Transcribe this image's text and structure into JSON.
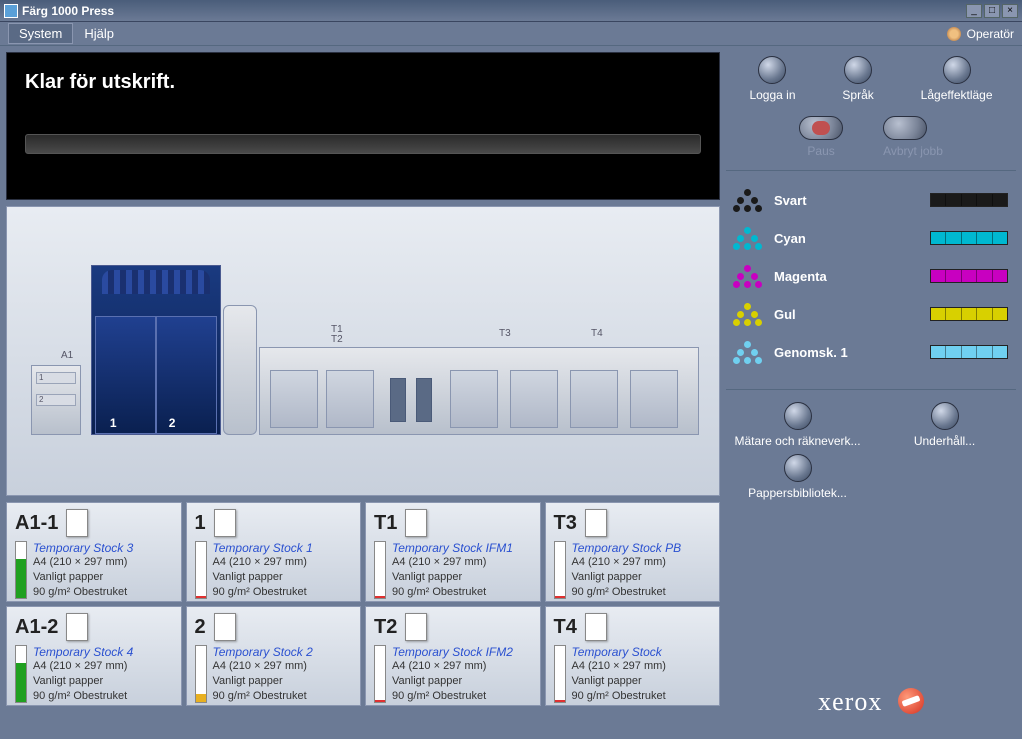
{
  "window": {
    "title": "Färg 1000 Press"
  },
  "menu": {
    "system": "System",
    "help": "Hjälp",
    "operator": "Operatör"
  },
  "status": {
    "message": "Klar för utskrift."
  },
  "actions": {
    "login": "Logga in",
    "language": "Språk",
    "lowpower": "Lågeffektläge",
    "pause": "Paus",
    "cancel": "Avbryt jobb",
    "meters": "Mätare och räkneverk...",
    "maintenance": "Underhåll...",
    "paperlib": "Pappersbibliotek..."
  },
  "toners": [
    {
      "name": "Svart",
      "color": "#1a1a1a"
    },
    {
      "name": "Cyan",
      "color": "#00b8d0"
    },
    {
      "name": "Magenta",
      "color": "#c800c0"
    },
    {
      "name": "Gul",
      "color": "#d8d000"
    },
    {
      "name": "Genomsk. 1",
      "color": "#70d0f0"
    }
  ],
  "diagram": {
    "a1": "A1",
    "n1": "1",
    "n2": "2",
    "t1": "T1",
    "t2": "T2",
    "t3": "T3",
    "t4": "T4"
  },
  "trays": [
    {
      "id": "A1-1",
      "stock": "Temporary Stock 3",
      "size": "A4 (210 × 297 mm)",
      "type": "Vanligt papper",
      "weight": "90 g/m²  Obestruket",
      "fill": 70,
      "fillColor": "#20a020"
    },
    {
      "id": "1",
      "stock": "Temporary Stock 1",
      "size": "A4 (210 × 297 mm)",
      "type": "Vanligt papper",
      "weight": "90 g/m²  Obestruket",
      "fill": 4,
      "fillColor": "#e03030"
    },
    {
      "id": "T1",
      "stock": "Temporary Stock IFM1",
      "size": "A4 (210 × 297 mm)",
      "type": "Vanligt papper",
      "weight": "90 g/m²  Obestruket",
      "fill": 4,
      "fillColor": "#e03030"
    },
    {
      "id": "T3",
      "stock": "Temporary Stock PB",
      "size": "A4 (210 × 297 mm)",
      "type": "Vanligt papper",
      "weight": "90 g/m²  Obestruket",
      "fill": 4,
      "fillColor": "#e03030"
    },
    {
      "id": "A1-2",
      "stock": "Temporary Stock 4",
      "size": "A4 (210 × 297 mm)",
      "type": "Vanligt papper",
      "weight": "90 g/m²  Obestruket",
      "fill": 70,
      "fillColor": "#20a020"
    },
    {
      "id": "2",
      "stock": "Temporary Stock 2",
      "size": "A4 (210 × 297 mm)",
      "type": "Vanligt papper",
      "weight": "90 g/m²  Obestruket",
      "fill": 15,
      "fillColor": "#e8b020"
    },
    {
      "id": "T2",
      "stock": "Temporary Stock IFM2",
      "size": "A4 (210 × 297 mm)",
      "type": "Vanligt papper",
      "weight": "90 g/m²  Obestruket",
      "fill": 4,
      "fillColor": "#e03030"
    },
    {
      "id": "T4",
      "stock": "Temporary Stock",
      "size": "A4 (210 × 297 mm)",
      "type": "Vanligt papper",
      "weight": "90 g/m²  Obestruket",
      "fill": 4,
      "fillColor": "#e03030"
    }
  ],
  "brand": "xerox"
}
